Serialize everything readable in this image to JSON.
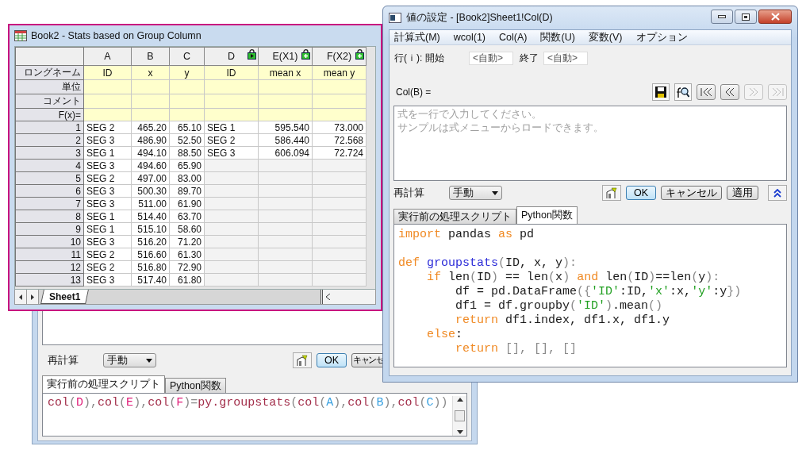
{
  "workbook": {
    "title": "Book2 - Stats based on Group Column",
    "columns": [
      {
        "name": "A",
        "kind": "text"
      },
      {
        "name": "B",
        "kind": "number"
      },
      {
        "name": "C",
        "kind": "number"
      },
      {
        "name": "D",
        "kind": "text",
        "locked": true,
        "play": true
      },
      {
        "name": "E(X1)",
        "kind": "number",
        "locked": true,
        "play": false
      },
      {
        "name": "F(X2)",
        "kind": "number",
        "locked": true,
        "play": false
      }
    ],
    "label_rows": [
      {
        "label": "ロングネーム",
        "values": [
          "ID",
          "x",
          "y",
          "ID",
          "mean x",
          "mean y"
        ]
      },
      {
        "label": "単位"
      },
      {
        "label": "コメント"
      },
      {
        "label": "F(x)="
      }
    ],
    "rows": [
      {
        "num": "1",
        "values": [
          "SEG 2",
          "465.20",
          "65.10",
          "SEG 1",
          "595.540",
          "73.000"
        ]
      },
      {
        "num": "2",
        "values": [
          "SEG 3",
          "486.90",
          "52.50",
          "SEG 2",
          "586.440",
          "72.568"
        ]
      },
      {
        "num": "3",
        "values": [
          "SEG 1",
          "494.10",
          "88.50",
          "SEG 3",
          "606.094",
          "72.724"
        ]
      },
      {
        "num": "4",
        "values": [
          "SEG 3",
          "494.60",
          "65.90"
        ]
      },
      {
        "num": "5",
        "values": [
          "SEG 2",
          "497.00",
          "83.00"
        ]
      },
      {
        "num": "6",
        "values": [
          "SEG 3",
          "500.30",
          "89.70"
        ]
      },
      {
        "num": "7",
        "values": [
          "SEG 3",
          "511.00",
          "61.90"
        ]
      },
      {
        "num": "8",
        "values": [
          "SEG 1",
          "514.40",
          "63.70"
        ]
      },
      {
        "num": "9",
        "values": [
          "SEG 1",
          "515.10",
          "58.60"
        ]
      },
      {
        "num": "10",
        "values": [
          "SEG 3",
          "516.20",
          "71.20"
        ]
      },
      {
        "num": "11",
        "values": [
          "SEG 2",
          "516.60",
          "61.30"
        ]
      },
      {
        "num": "12",
        "values": [
          "SEG 2",
          "516.80",
          "72.90"
        ]
      },
      {
        "num": "13",
        "values": [
          "SEG 3",
          "517.40",
          "61.80"
        ]
      }
    ],
    "sheet_tabs": [
      {
        "label": "Sheet1",
        "selected": true
      }
    ]
  },
  "back_dialog": {
    "recalc_label": "再計算",
    "recalc_value": "手動",
    "buttons": [
      "OK",
      "キャンセ"
    ],
    "tabs": [
      {
        "label": "実行前の処理スクリプト",
        "selected": true
      },
      {
        "label": "Python関数",
        "selected": false
      }
    ],
    "script": [
      {
        "text": "col",
        "kind": "call"
      },
      {
        "text": "(",
        "kind": "punct"
      },
      {
        "text": "D",
        "kind": "ref_out"
      },
      {
        "text": ")",
        "kind": "punct"
      },
      {
        "text": ",",
        "kind": "punct"
      },
      {
        "text": "col",
        "kind": "call"
      },
      {
        "text": "(",
        "kind": "punct"
      },
      {
        "text": "E",
        "kind": "ref_out"
      },
      {
        "text": ")",
        "kind": "punct"
      },
      {
        "text": ",",
        "kind": "punct"
      },
      {
        "text": "col",
        "kind": "call"
      },
      {
        "text": "(",
        "kind": "punct"
      },
      {
        "text": "F",
        "kind": "ref_out"
      },
      {
        "text": ")",
        "kind": "punct"
      },
      {
        "text": "=",
        "kind": "punct"
      },
      {
        "text": "py.groupstats",
        "kind": "call"
      },
      {
        "text": "(",
        "kind": "punct"
      },
      {
        "text": "col",
        "kind": "call"
      },
      {
        "text": "(",
        "kind": "punct"
      },
      {
        "text": "A",
        "kind": "ref_in"
      },
      {
        "text": ")",
        "kind": "punct"
      },
      {
        "text": ",",
        "kind": "punct"
      },
      {
        "text": "col",
        "kind": "call"
      },
      {
        "text": "(",
        "kind": "punct"
      },
      {
        "text": "B",
        "kind": "ref_in"
      },
      {
        "text": ")",
        "kind": "punct"
      },
      {
        "text": ",",
        "kind": "punct"
      },
      {
        "text": "col",
        "kind": "call"
      },
      {
        "text": "(",
        "kind": "punct"
      },
      {
        "text": "C",
        "kind": "ref_in"
      },
      {
        "text": "))",
        "kind": "punct"
      }
    ]
  },
  "front_dialog": {
    "title": "値の設定 - [Book2]Sheet1!Col(D)",
    "menu": [
      "計算式(M)",
      "wcol(1)",
      "Col(A)",
      "関数(U)",
      "変数(V)",
      "オプション"
    ],
    "range_label": "行(ｉ): 開始",
    "start_placeholder": "<自動>",
    "end_label": "終了",
    "end_placeholder": "<自動>",
    "formula_label": "Col(B) =",
    "nav_buttons": [
      {
        "kind": "first",
        "disabled": false
      },
      {
        "kind": "prev",
        "disabled": false
      },
      {
        "kind": "next",
        "disabled": true
      },
      {
        "kind": "last",
        "disabled": true
      }
    ],
    "formula_placeholder": "式を一行で入力してください。サンプルは式メニューからロードできます。",
    "recalc_label": "再計算",
    "recalc_value": "手動",
    "buttons": [
      "OK",
      "キャンセル",
      "適用"
    ],
    "tabs": [
      {
        "label": "実行前の処理スクリプト",
        "selected": false
      },
      {
        "label": "Python関数",
        "selected": true
      }
    ],
    "code": [
      {
        "tokens": [
          {
            "text": "import",
            "kind": "keyword"
          },
          {
            "text": " pandas ",
            "kind": "plain"
          },
          {
            "text": "as",
            "kind": "keyword"
          },
          {
            "text": " pd",
            "kind": "plain"
          }
        ]
      },
      {
        "kind": "blank"
      },
      {
        "tokens": [
          {
            "text": "def",
            "kind": "keyword"
          },
          {
            "text": " groupstats",
            "kind": "func"
          },
          {
            "text": "(",
            "kind": "punct"
          },
          {
            "text": "ID, x, y",
            "kind": "plain"
          },
          {
            "text": "):",
            "kind": "punct"
          }
        ]
      },
      {
        "tokens": [
          {
            "text": "    if",
            "kind": "keyword"
          },
          {
            "text": " len",
            "kind": "plain"
          },
          {
            "text": "(",
            "kind": "punct"
          },
          {
            "text": "ID",
            "kind": "plain"
          },
          {
            "text": ")",
            "kind": "punct"
          },
          {
            "text": " == len",
            "kind": "plain"
          },
          {
            "text": "(",
            "kind": "punct"
          },
          {
            "text": "x",
            "kind": "plain"
          },
          {
            "text": ")",
            "kind": "punct"
          },
          {
            "text": " and",
            "kind": "keyword"
          },
          {
            "text": " len",
            "kind": "plain"
          },
          {
            "text": "(",
            "kind": "punct"
          },
          {
            "text": "ID",
            "kind": "plain"
          },
          {
            "text": ")",
            "kind": "punct"
          },
          {
            "text": "==len",
            "kind": "plain"
          },
          {
            "text": "(",
            "kind": "punct"
          },
          {
            "text": "y",
            "kind": "plain"
          },
          {
            "text": "):",
            "kind": "punct"
          }
        ]
      },
      {
        "tokens": [
          {
            "text": "        df = pd.DataFrame",
            "kind": "plain"
          },
          {
            "text": "({",
            "kind": "punct"
          },
          {
            "text": "'ID'",
            "kind": "string"
          },
          {
            "text": ":ID,",
            "kind": "plain"
          },
          {
            "text": "'x'",
            "kind": "string"
          },
          {
            "text": ":x,",
            "kind": "plain"
          },
          {
            "text": "'y'",
            "kind": "string"
          },
          {
            "text": ":y",
            "kind": "plain"
          },
          {
            "text": "})",
            "kind": "punct"
          }
        ]
      },
      {
        "tokens": [
          {
            "text": "        df1 = df.groupby",
            "kind": "plain"
          },
          {
            "text": "(",
            "kind": "punct"
          },
          {
            "text": "'ID'",
            "kind": "string"
          },
          {
            "text": ")",
            "kind": "punct"
          },
          {
            "text": ".mean",
            "kind": "plain"
          },
          {
            "text": "()",
            "kind": "punct"
          }
        ]
      },
      {
        "tokens": [
          {
            "text": "        return",
            "kind": "keyword"
          },
          {
            "text": " df1.index, df1.x, df1.y",
            "kind": "plain"
          }
        ]
      },
      {
        "tokens": [
          {
            "text": "    else",
            "kind": "keyword"
          },
          {
            "text": ":",
            "kind": "plain"
          }
        ]
      },
      {
        "tokens": [
          {
            "text": "        return",
            "kind": "keyword"
          },
          {
            "text": " [], [], []",
            "kind": "punct"
          }
        ]
      }
    ]
  }
}
